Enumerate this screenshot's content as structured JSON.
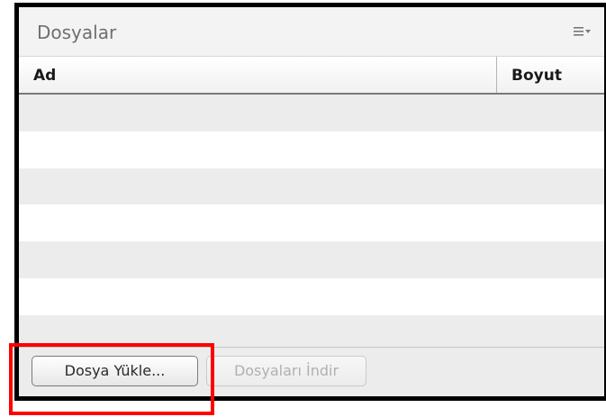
{
  "panel": {
    "title": "Dosyalar",
    "menu_icon": "list-menu-icon"
  },
  "table": {
    "columns": [
      "Ad",
      "Boyut"
    ],
    "rows": []
  },
  "footer": {
    "upload_label": "Dosya Yükle...",
    "download_label": "Dosyaları İndir"
  },
  "colors": {
    "frame": "#000000",
    "row_stripe": "#ececec",
    "highlight": "#ff0000",
    "disabled_text": "#b0b0b0"
  }
}
